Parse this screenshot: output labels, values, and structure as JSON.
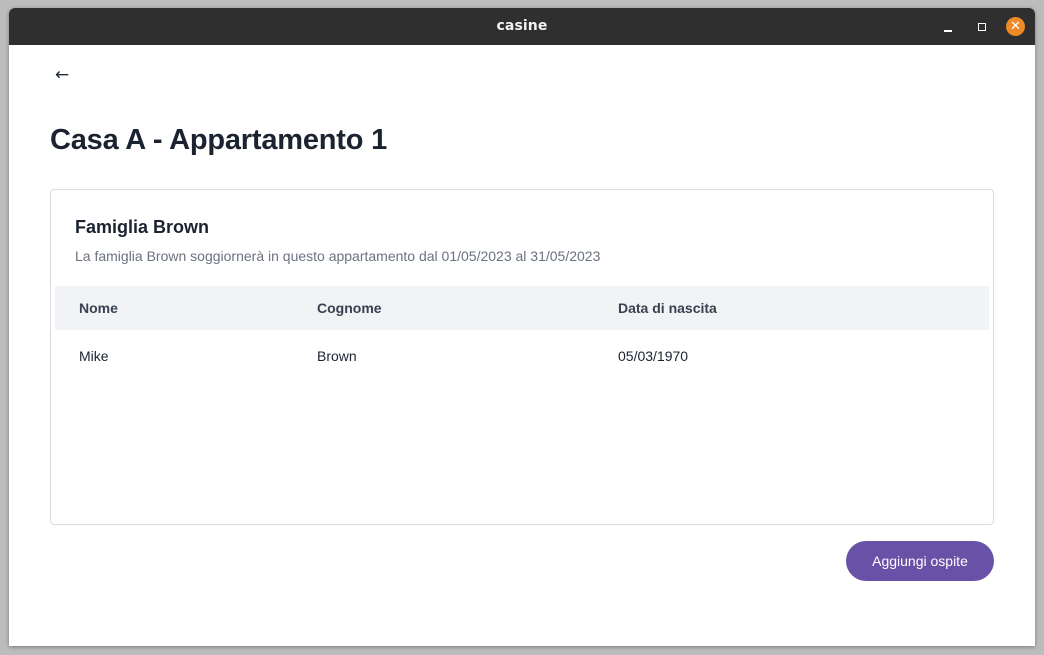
{
  "window": {
    "title": "casine",
    "controls": {
      "minimize_icon": "minimize-icon",
      "maximize_icon": "maximize-icon",
      "close_icon": "close-icon",
      "close_glyph": "✕",
      "close_color": "#f08a26"
    }
  },
  "nav": {
    "back_icon": "arrow-left-icon",
    "back_glyph": "←"
  },
  "page": {
    "title": "Casa A - Appartamento 1"
  },
  "family": {
    "name": "Famiglia Brown",
    "description": "La famiglia Brown soggiornerà in questo appartamento dal 01/05/2023 al 31/05/2023",
    "table": {
      "headers": [
        "Nome",
        "Cognome",
        "Data di nascita"
      ],
      "rows": [
        [
          "Mike",
          "Brown",
          "05/03/1970"
        ]
      ]
    }
  },
  "actions": {
    "add_guest_label": "Aggiungi ospite"
  },
  "colors": {
    "accent": "#6851a7",
    "titlebar": "#2f2f2f",
    "table_header_bg": "#f2f3f5"
  }
}
